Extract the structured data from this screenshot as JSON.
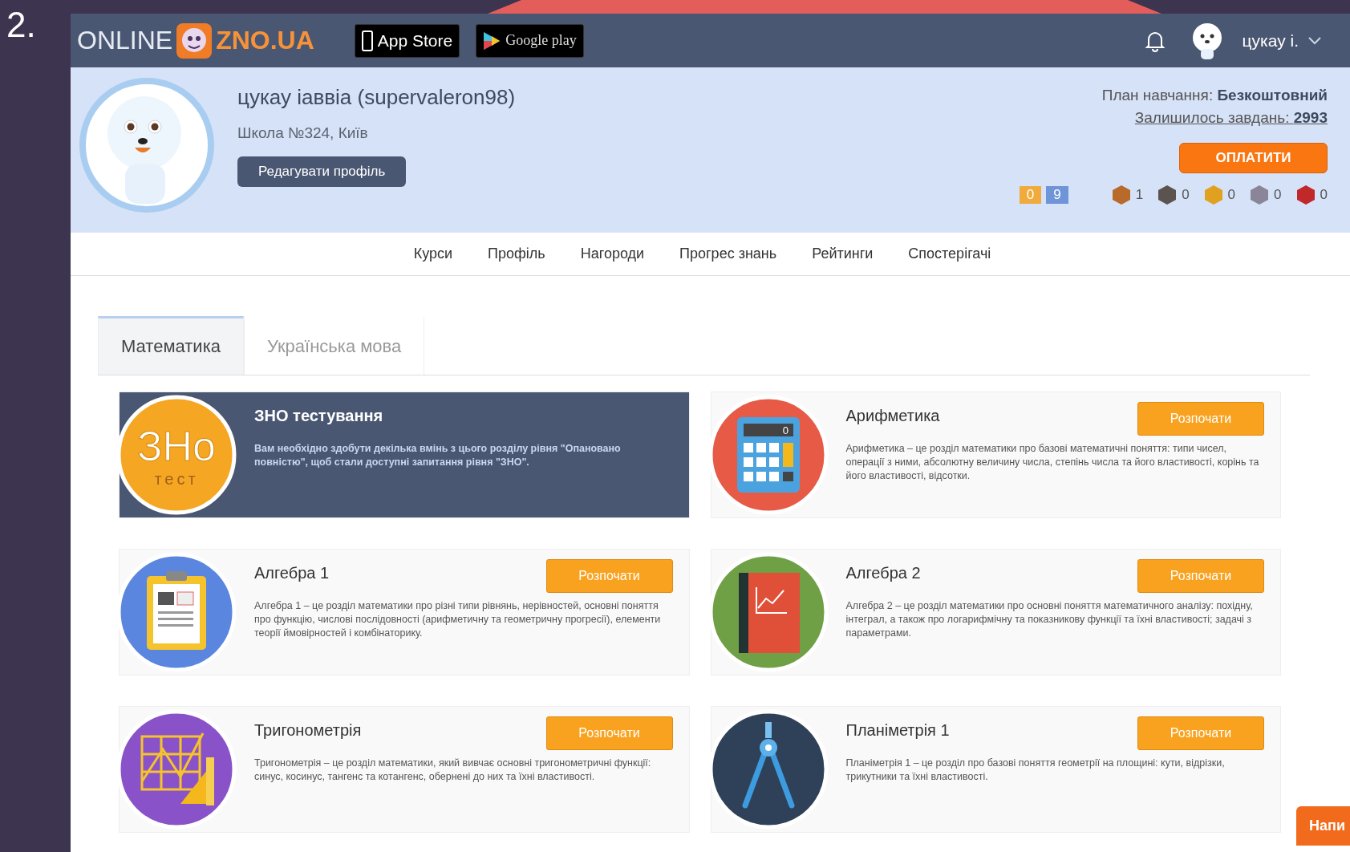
{
  "slide": {
    "number": "2."
  },
  "header": {
    "logo_left": "ONLINE",
    "logo_right": "ZNO.UA",
    "store_buttons": [
      "App Store",
      "Google play"
    ],
    "user": "цукау і."
  },
  "profile": {
    "name": "цукау іаввіа (supervaleron98)",
    "school": "Школа №324, Київ",
    "edit_button": "Редагувати профіль",
    "plan_label": "План навчання:",
    "plan_value": "Безкоштовний",
    "tasks_label": "Залишилось завдань:",
    "tasks_value": "2993",
    "pay_button": "ОПЛАТИТИ",
    "counters": [
      {
        "value": "0",
        "color": "#f0ab3c"
      },
      {
        "value": "9",
        "color": "#6f95d8"
      }
    ],
    "medals": [
      {
        "count": "1",
        "color": "#b86a2a"
      },
      {
        "count": "0",
        "color": "#5a5350"
      },
      {
        "count": "0",
        "color": "#e0a020"
      },
      {
        "count": "0",
        "color": "#8a8598"
      },
      {
        "count": "0",
        "color": "#c0282a"
      }
    ]
  },
  "nav": [
    {
      "label": "Курси"
    },
    {
      "label": "Профіль"
    },
    {
      "label": "Нагороди"
    },
    {
      "label": "Прогрес знань"
    },
    {
      "label": "Рейтинги"
    },
    {
      "label": "Спостерігачі"
    }
  ],
  "tabs": [
    {
      "label": "Математика",
      "selected": true
    },
    {
      "label": "Українська мова",
      "selected": false
    }
  ],
  "courses": [
    {
      "kind": "locked",
      "title": "ЗНО тестування",
      "description": "Вам необхідно здобути декілька вмінь з цього розділу рівня \"Опановано повністю\", щоб стали доступні запитання рівня \"ЗНО\".",
      "badge_top": "ЗНо",
      "badge_bottom": "тест"
    },
    {
      "kind": "course",
      "title": "Арифметика",
      "description": "Арифметика – це розділ математики про базові математичні поняття: типи чисел, операції з ними, абсолютну величину числа, степінь числа та його властивості, корінь та його властивості, відсотки.",
      "button": "Розпочати",
      "display": "0"
    },
    {
      "kind": "course",
      "title": "Алгебра 1",
      "description": "Алгебра 1 – це розділ математики про різні типи рівнянь, нерівностей, основні поняття про функцію, числові послідовності (арифметичну та геометричну прогресії), елементи теорії ймовірностей і комбінаторику.",
      "button": "Розпочати"
    },
    {
      "kind": "course",
      "title": "Алгебра 2",
      "description": "Алгебра 2 – це розділ математики про основні поняття математичного аналізу: похідну, інтеграл, а також про логарифмічну та показникову функції та їхні властивості; задачі з параметрами.",
      "button": "Розпочати"
    },
    {
      "kind": "course",
      "title": "Тригонометрія",
      "description": "Тригонометрія – це розділ математики, який вивчає основні тригонометричні функції: синус, косинус, тангенс та котангенс, обернені до них та їхні властивості.",
      "button": "Розпочати"
    },
    {
      "kind": "course",
      "title": "Планіметрія 1",
      "description": "Планіметрія 1 – це розділ про базові поняття геометрії на площині: кути, відрізки, трикутники та їхні властивості.",
      "button": "Розпочати"
    }
  ],
  "chat_button": "Напи"
}
